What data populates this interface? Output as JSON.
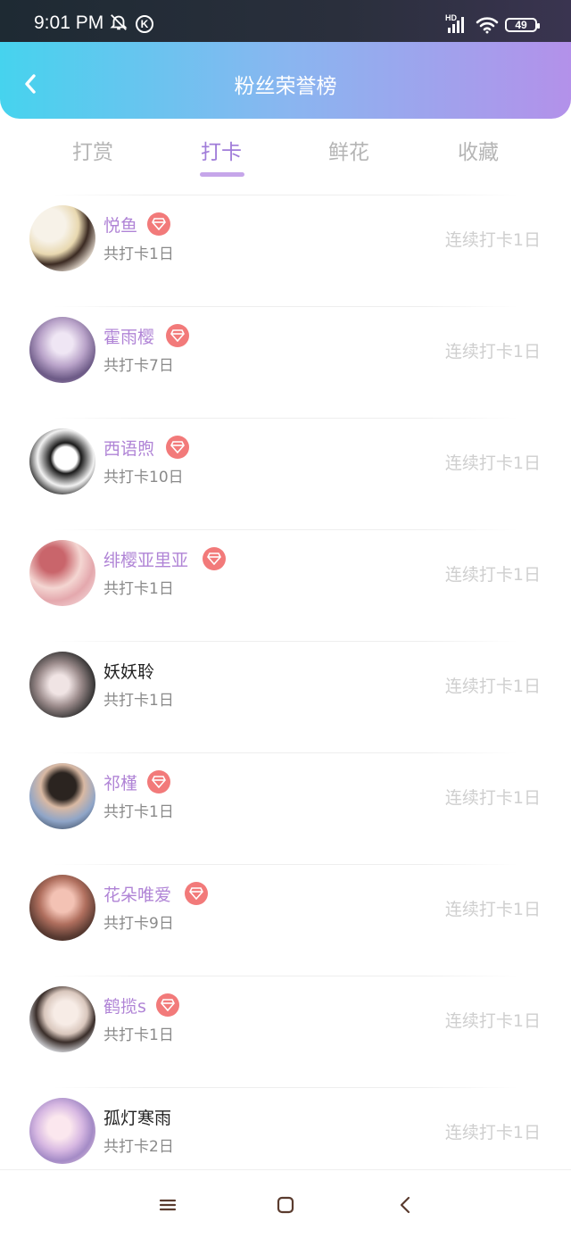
{
  "status_bar": {
    "time": "9:01 PM",
    "network": "HD",
    "battery": "49",
    "icons": [
      "notifications-off-icon",
      "k-app-icon",
      "signal-icon",
      "wifi-icon",
      "battery-icon"
    ]
  },
  "header": {
    "title": "粉丝荣誉榜",
    "back_icon": "chevron-left-icon"
  },
  "tabs": [
    {
      "label": "打赏",
      "active": false
    },
    {
      "label": "打卡",
      "active": true
    },
    {
      "label": "鲜花",
      "active": false
    },
    {
      "label": "收藏",
      "active": false
    }
  ],
  "colors": {
    "accent": "#a07cd9",
    "vip_name": "#b084d6",
    "vip_badge": "#f27a7a",
    "header_left": "#46d3ee",
    "header_right": "#b391ea"
  },
  "fans": [
    {
      "name": "悦鱼",
      "total": "共打卡1日",
      "streak": "连续打卡1日",
      "vip": true
    },
    {
      "name": "霍雨樱",
      "total": "共打卡7日",
      "streak": "连续打卡1日",
      "vip": true
    },
    {
      "name": "西语煦",
      "total": "共打卡10日",
      "streak": "连续打卡1日",
      "vip": true
    },
    {
      "name": "绯樱亚里亚",
      "total": "共打卡1日",
      "streak": "连续打卡1日",
      "vip": true
    },
    {
      "name": "妖妖聆",
      "total": "共打卡1日",
      "streak": "连续打卡1日",
      "vip": false
    },
    {
      "name": "祁槿",
      "total": "共打卡1日",
      "streak": "连续打卡1日",
      "vip": true
    },
    {
      "name": "花朵唯爱",
      "total": "共打卡9日",
      "streak": "连续打卡1日",
      "vip": true
    },
    {
      "name": "鹤揽s",
      "total": "共打卡1日",
      "streak": "连续打卡1日",
      "vip": true
    },
    {
      "name": "孤灯寒雨",
      "total": "共打卡2日",
      "streak": "连续打卡1日",
      "vip": false
    }
  ],
  "nav_bar": {
    "icons": [
      "menu-icon",
      "home-square-icon",
      "back-triangle-icon"
    ]
  }
}
